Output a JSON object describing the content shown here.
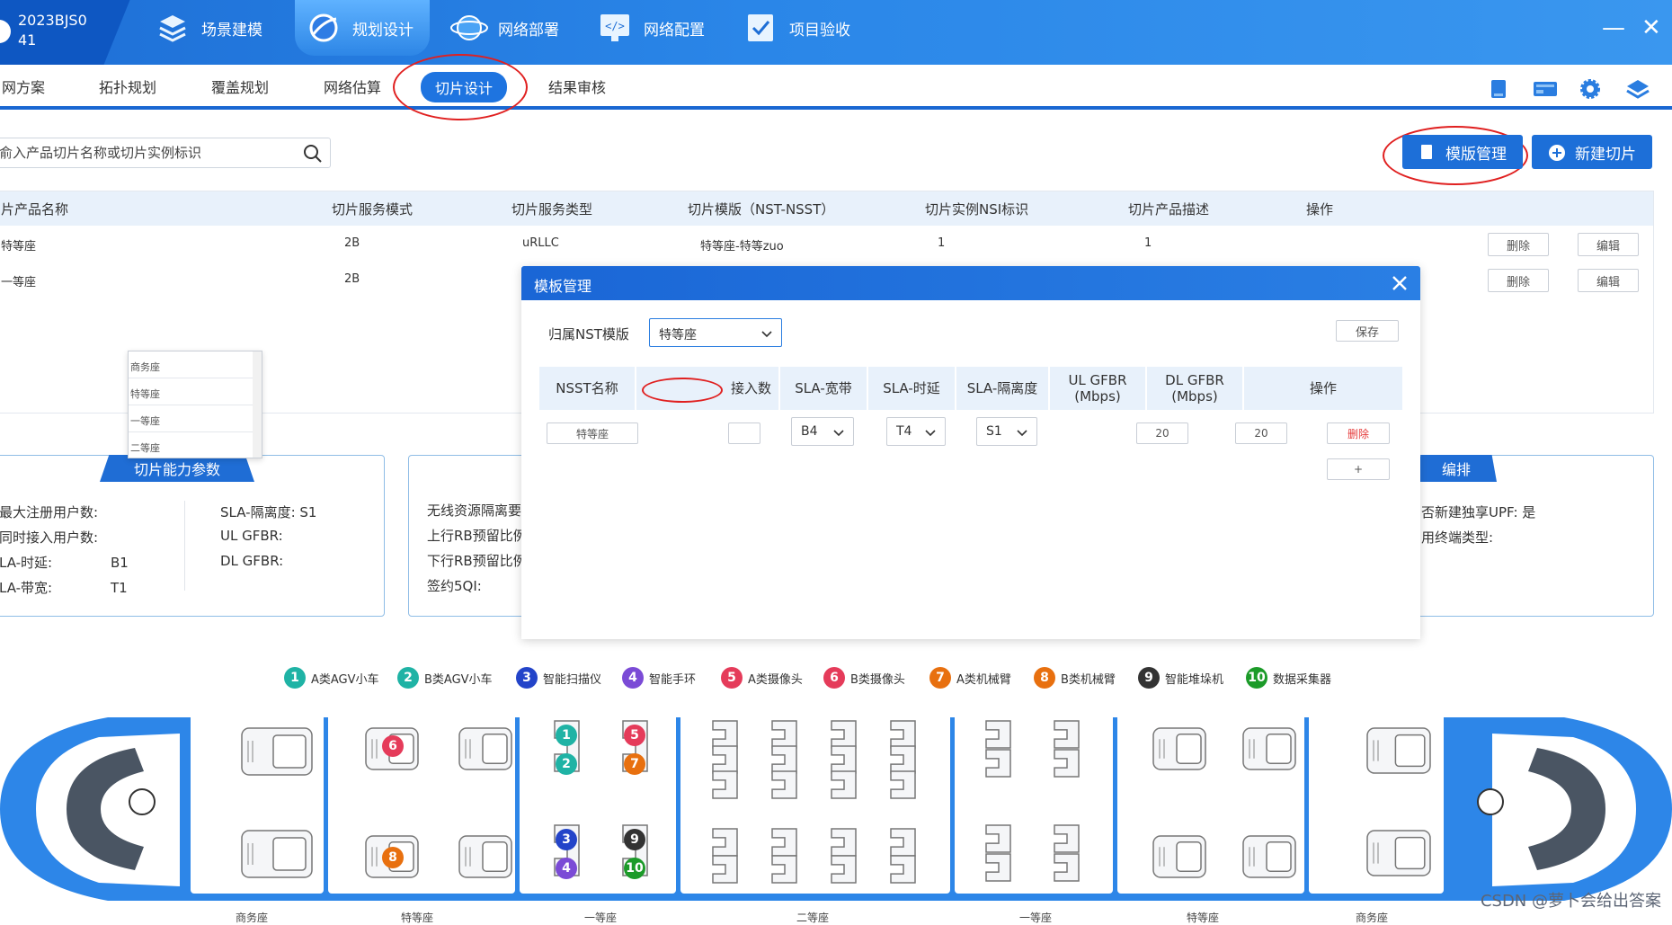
{
  "app": {
    "project_id": "2023BJS041",
    "top_tabs": [
      {
        "label": "场景建模",
        "icon": "stack-icon"
      },
      {
        "label": "规划设计",
        "icon": "planet-icon"
      },
      {
        "label": "网络部署",
        "icon": "globe-icon"
      },
      {
        "label": "网络配置",
        "icon": "code-monitor-icon"
      },
      {
        "label": "项目验收",
        "icon": "checklist-icon"
      }
    ],
    "active_top_tab": "规划设计",
    "window_controls": {
      "minimize": "—",
      "close": "✕"
    }
  },
  "subnav": {
    "items": [
      "网方案",
      "拓扑规划",
      "覆盖规划",
      "网络估算",
      "切片设计",
      "结果审核"
    ],
    "active": "切片设计"
  },
  "toolbar_icons": [
    "document-icon",
    "monitor-icon",
    "gear-icon",
    "layers-icon"
  ],
  "search": {
    "placeholder": "俞入产品切片名称或切片实例标识"
  },
  "buttons": {
    "template_mgmt": "模版管理",
    "new_slice": "新建切片"
  },
  "slice_table": {
    "headers": [
      "片产品名称",
      "切片服务模式",
      "切片服务类型",
      "切片模版（NST-NSST）",
      "切片实例NSI标识",
      "切片产品描述",
      "操作"
    ],
    "rows": [
      {
        "name": "特等座",
        "mode": "2B",
        "type": "uRLLC",
        "template": "特等座-特等zuo",
        "nsi": "1",
        "desc": "1"
      },
      {
        "name": "一等座",
        "mode": "2B",
        "type": "",
        "template": "",
        "nsi": "",
        "desc": ""
      }
    ],
    "delete_label": "删除",
    "edit_label": "编辑"
  },
  "capability_panel": {
    "title": "切片能力参数",
    "left": [
      "最大注册用户数:",
      "同时接入用户数:",
      "LA-时延:",
      "LA-带宽:"
    ],
    "left_values": [
      "",
      "",
      "B1",
      "T1"
    ],
    "right": [
      "SLA-隔离度:  S1",
      "UL GFBR:",
      "DL GFBR:"
    ]
  },
  "ran_panel": {
    "lines": [
      "无线资源隔离要",
      "上行RB预留比例",
      "下行RB预留比例",
      "签约5QI:"
    ]
  },
  "orch_panel": {
    "title": "编排",
    "lines": [
      "否新建独享UPF:  是",
      "用终端类型:"
    ]
  },
  "modal": {
    "title": "模板管理",
    "nst_label": "归属NST模版",
    "nst_value": "特等座",
    "save_label": "保存",
    "grid_headers": [
      "NSST名称",
      "接入数",
      "SLA-宽带",
      "SLA-时延",
      "SLA-隔离度",
      "UL GFBR (Mbps)",
      "DL GFBR (Mbps)",
      "操作"
    ],
    "row": {
      "nsst_name": "特等座",
      "bandwidth": "B4",
      "latency": "T4",
      "isolation": "S1",
      "ul": "20",
      "dl": "20",
      "delete": "删除"
    },
    "add_label": "+",
    "dropdown_options": [
      "商务座",
      "特等座",
      "一等座",
      "二等座"
    ]
  },
  "legend": [
    {
      "n": "1",
      "label": "A类AGV小车",
      "color": "#1fb3a5"
    },
    {
      "n": "2",
      "label": "B类AGV小车",
      "color": "#1fb3a5"
    },
    {
      "n": "3",
      "label": "智能扫描仪",
      "color": "#2344c9"
    },
    {
      "n": "4",
      "label": "智能手环",
      "color": "#7b4bd6"
    },
    {
      "n": "5",
      "label": "A类摄像头",
      "color": "#e53b5a"
    },
    {
      "n": "6",
      "label": "B类摄像头",
      "color": "#e53b5a"
    },
    {
      "n": "7",
      "label": "A类机械臂",
      "color": "#e8700f"
    },
    {
      "n": "8",
      "label": "B类机械臂",
      "color": "#e8700f"
    },
    {
      "n": "9",
      "label": "智能堆垛机",
      "color": "#333333"
    },
    {
      "n": "10",
      "label": "数据采集器",
      "color": "#1c9b29"
    }
  ],
  "car_labels": [
    "商务座",
    "特等座",
    "一等座",
    "二等座",
    "一等座",
    "特等座",
    "商务座"
  ],
  "watermark": "CSDN @萝卜会给出答案",
  "colors": {
    "primary": "#1d6fd8",
    "header_bg": "#e8f1fb",
    "accent_red": "#e02020"
  }
}
